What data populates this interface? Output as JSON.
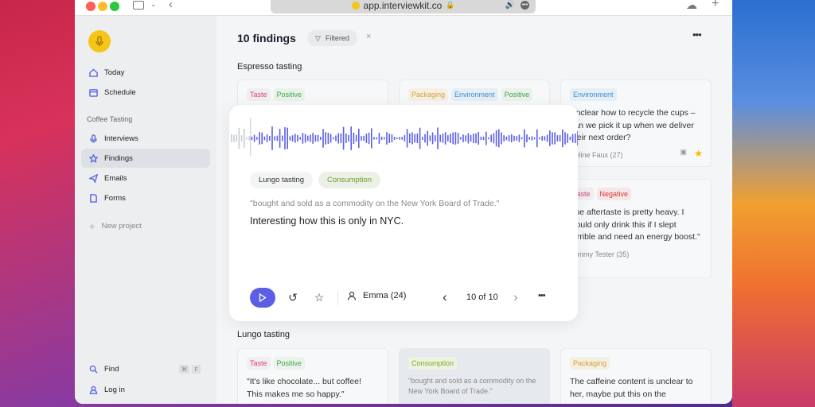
{
  "browser": {
    "url": "app.interviewkit.co"
  },
  "sidebar": {
    "items": [
      {
        "label": "Today"
      },
      {
        "label": "Schedule"
      }
    ],
    "section": "Coffee Tasting",
    "project_items": [
      {
        "label": "Interviews"
      },
      {
        "label": "Findings"
      },
      {
        "label": "Emails"
      },
      {
        "label": "Forms"
      }
    ],
    "new_project": "New project",
    "find": "Find",
    "find_shortcut": [
      "⌘",
      "F"
    ],
    "login": "Log in"
  },
  "header": {
    "title": "10 findings",
    "filter": "Filtered"
  },
  "sections": [
    {
      "title": "Espresso tasting",
      "cards": [
        {
          "tags": [
            {
              "label": "Taste",
              "cls": "t-taste"
            },
            {
              "label": "Positive",
              "cls": "t-pos"
            }
          ],
          "text": ""
        },
        {
          "tags": [
            {
              "label": "Packaging",
              "cls": "t-pack"
            },
            {
              "label": "Environment",
              "cls": "t-env"
            },
            {
              "label": "Positive",
              "cls": "t-pos"
            }
          ],
          "text": ""
        },
        {
          "tags": [
            {
              "label": "Environment",
              "cls": "t-env"
            }
          ],
          "text": "Unclear how to recycle the cups – can we pick it up when we deliver their next order?",
          "meta": "Celine Faux (27)"
        },
        {
          "tags": [
            {
              "label": "Taste",
              "cls": "t-taste"
            },
            {
              "label": "Negative",
              "cls": "t-neg"
            }
          ],
          "text": "The aftertaste is pretty heavy. I would only drink this if I slept terrible and need an energy boost.\"",
          "meta": "Tommy Tester (35)"
        }
      ]
    },
    {
      "title": "Lungo tasting",
      "cards": [
        {
          "tags": [
            {
              "label": "Taste",
              "cls": "t-taste"
            },
            {
              "label": "Positive",
              "cls": "t-pos"
            }
          ],
          "text": "\"It's like chocolate... but coffee! This makes me so happy.\""
        },
        {
          "tags": [
            {
              "label": "Consumption",
              "cls": "t-cons"
            }
          ],
          "text": "\"bought and sold as a commodity on the New York Board of Trade.\""
        },
        {
          "tags": [
            {
              "label": "Packaging",
              "cls": "t-pack"
            }
          ],
          "text": "The caffeine content is unclear to her, maybe put this on the"
        }
      ]
    }
  ],
  "popup": {
    "chips": [
      "Lungo tasting",
      "Consumption"
    ],
    "quote": "\"bought and sold as a commodity on the New York Board of Trade.\"",
    "note": "Interesting how this is only in NYC.",
    "person": "Emma (24)",
    "pager": "10 of 10",
    "progress": 0.06
  },
  "colors": {
    "accent": "#5b5fe6",
    "logo": "#f5c518"
  }
}
